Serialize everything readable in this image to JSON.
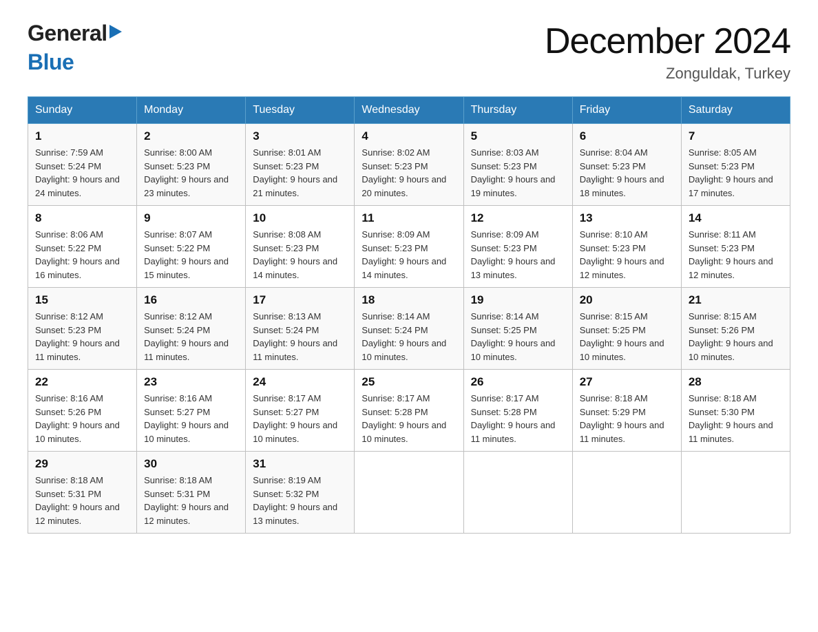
{
  "header": {
    "logo_general": "General",
    "logo_blue": "Blue",
    "month_title": "December 2024",
    "location": "Zonguldak, Turkey"
  },
  "days_of_week": [
    "Sunday",
    "Monday",
    "Tuesday",
    "Wednesday",
    "Thursday",
    "Friday",
    "Saturday"
  ],
  "weeks": [
    [
      {
        "day": "1",
        "sunrise": "Sunrise: 7:59 AM",
        "sunset": "Sunset: 5:24 PM",
        "daylight": "Daylight: 9 hours and 24 minutes."
      },
      {
        "day": "2",
        "sunrise": "Sunrise: 8:00 AM",
        "sunset": "Sunset: 5:23 PM",
        "daylight": "Daylight: 9 hours and 23 minutes."
      },
      {
        "day": "3",
        "sunrise": "Sunrise: 8:01 AM",
        "sunset": "Sunset: 5:23 PM",
        "daylight": "Daylight: 9 hours and 21 minutes."
      },
      {
        "day": "4",
        "sunrise": "Sunrise: 8:02 AM",
        "sunset": "Sunset: 5:23 PM",
        "daylight": "Daylight: 9 hours and 20 minutes."
      },
      {
        "day": "5",
        "sunrise": "Sunrise: 8:03 AM",
        "sunset": "Sunset: 5:23 PM",
        "daylight": "Daylight: 9 hours and 19 minutes."
      },
      {
        "day": "6",
        "sunrise": "Sunrise: 8:04 AM",
        "sunset": "Sunset: 5:23 PM",
        "daylight": "Daylight: 9 hours and 18 minutes."
      },
      {
        "day": "7",
        "sunrise": "Sunrise: 8:05 AM",
        "sunset": "Sunset: 5:23 PM",
        "daylight": "Daylight: 9 hours and 17 minutes."
      }
    ],
    [
      {
        "day": "8",
        "sunrise": "Sunrise: 8:06 AM",
        "sunset": "Sunset: 5:22 PM",
        "daylight": "Daylight: 9 hours and 16 minutes."
      },
      {
        "day": "9",
        "sunrise": "Sunrise: 8:07 AM",
        "sunset": "Sunset: 5:22 PM",
        "daylight": "Daylight: 9 hours and 15 minutes."
      },
      {
        "day": "10",
        "sunrise": "Sunrise: 8:08 AM",
        "sunset": "Sunset: 5:23 PM",
        "daylight": "Daylight: 9 hours and 14 minutes."
      },
      {
        "day": "11",
        "sunrise": "Sunrise: 8:09 AM",
        "sunset": "Sunset: 5:23 PM",
        "daylight": "Daylight: 9 hours and 14 minutes."
      },
      {
        "day": "12",
        "sunrise": "Sunrise: 8:09 AM",
        "sunset": "Sunset: 5:23 PM",
        "daylight": "Daylight: 9 hours and 13 minutes."
      },
      {
        "day": "13",
        "sunrise": "Sunrise: 8:10 AM",
        "sunset": "Sunset: 5:23 PM",
        "daylight": "Daylight: 9 hours and 12 minutes."
      },
      {
        "day": "14",
        "sunrise": "Sunrise: 8:11 AM",
        "sunset": "Sunset: 5:23 PM",
        "daylight": "Daylight: 9 hours and 12 minutes."
      }
    ],
    [
      {
        "day": "15",
        "sunrise": "Sunrise: 8:12 AM",
        "sunset": "Sunset: 5:23 PM",
        "daylight": "Daylight: 9 hours and 11 minutes."
      },
      {
        "day": "16",
        "sunrise": "Sunrise: 8:12 AM",
        "sunset": "Sunset: 5:24 PM",
        "daylight": "Daylight: 9 hours and 11 minutes."
      },
      {
        "day": "17",
        "sunrise": "Sunrise: 8:13 AM",
        "sunset": "Sunset: 5:24 PM",
        "daylight": "Daylight: 9 hours and 11 minutes."
      },
      {
        "day": "18",
        "sunrise": "Sunrise: 8:14 AM",
        "sunset": "Sunset: 5:24 PM",
        "daylight": "Daylight: 9 hours and 10 minutes."
      },
      {
        "day": "19",
        "sunrise": "Sunrise: 8:14 AM",
        "sunset": "Sunset: 5:25 PM",
        "daylight": "Daylight: 9 hours and 10 minutes."
      },
      {
        "day": "20",
        "sunrise": "Sunrise: 8:15 AM",
        "sunset": "Sunset: 5:25 PM",
        "daylight": "Daylight: 9 hours and 10 minutes."
      },
      {
        "day": "21",
        "sunrise": "Sunrise: 8:15 AM",
        "sunset": "Sunset: 5:26 PM",
        "daylight": "Daylight: 9 hours and 10 minutes."
      }
    ],
    [
      {
        "day": "22",
        "sunrise": "Sunrise: 8:16 AM",
        "sunset": "Sunset: 5:26 PM",
        "daylight": "Daylight: 9 hours and 10 minutes."
      },
      {
        "day": "23",
        "sunrise": "Sunrise: 8:16 AM",
        "sunset": "Sunset: 5:27 PM",
        "daylight": "Daylight: 9 hours and 10 minutes."
      },
      {
        "day": "24",
        "sunrise": "Sunrise: 8:17 AM",
        "sunset": "Sunset: 5:27 PM",
        "daylight": "Daylight: 9 hours and 10 minutes."
      },
      {
        "day": "25",
        "sunrise": "Sunrise: 8:17 AM",
        "sunset": "Sunset: 5:28 PM",
        "daylight": "Daylight: 9 hours and 10 minutes."
      },
      {
        "day": "26",
        "sunrise": "Sunrise: 8:17 AM",
        "sunset": "Sunset: 5:28 PM",
        "daylight": "Daylight: 9 hours and 11 minutes."
      },
      {
        "day": "27",
        "sunrise": "Sunrise: 8:18 AM",
        "sunset": "Sunset: 5:29 PM",
        "daylight": "Daylight: 9 hours and 11 minutes."
      },
      {
        "day": "28",
        "sunrise": "Sunrise: 8:18 AM",
        "sunset": "Sunset: 5:30 PM",
        "daylight": "Daylight: 9 hours and 11 minutes."
      }
    ],
    [
      {
        "day": "29",
        "sunrise": "Sunrise: 8:18 AM",
        "sunset": "Sunset: 5:31 PM",
        "daylight": "Daylight: 9 hours and 12 minutes."
      },
      {
        "day": "30",
        "sunrise": "Sunrise: 8:18 AM",
        "sunset": "Sunset: 5:31 PM",
        "daylight": "Daylight: 9 hours and 12 minutes."
      },
      {
        "day": "31",
        "sunrise": "Sunrise: 8:19 AM",
        "sunset": "Sunset: 5:32 PM",
        "daylight": "Daylight: 9 hours and 13 minutes."
      },
      null,
      null,
      null,
      null
    ]
  ]
}
